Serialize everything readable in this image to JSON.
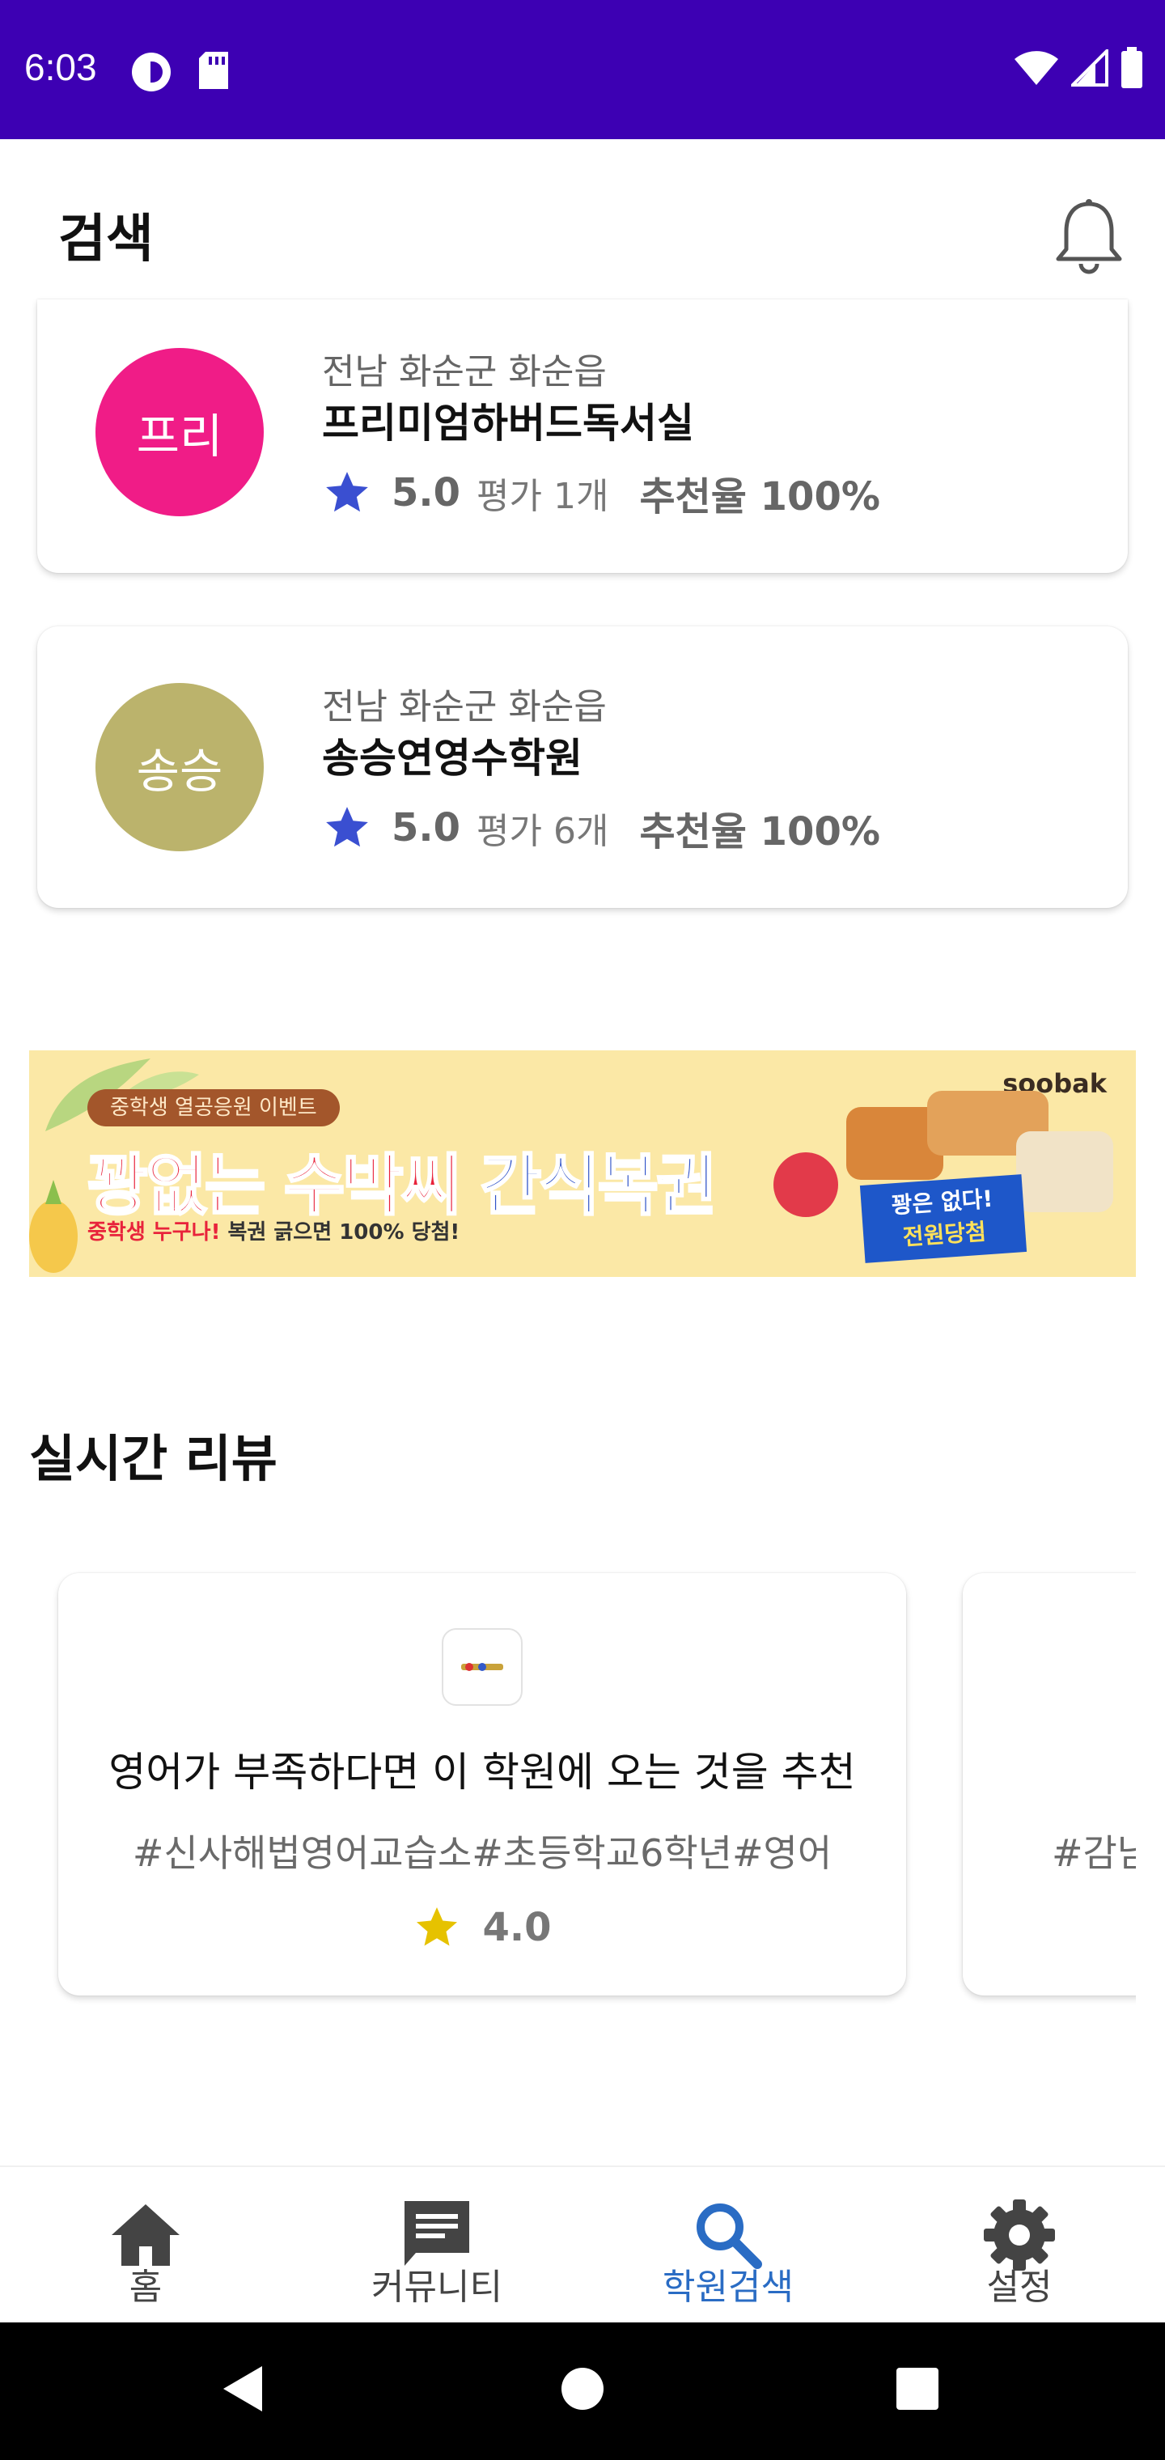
{
  "status_bar": {
    "time": "6:03",
    "bg": "#3d00b3"
  },
  "header": {
    "title": "검색",
    "notification_icon": "bell-icon"
  },
  "academies": [
    {
      "avatar_text": "프리",
      "avatar_color": "#f01c87",
      "region": "전남 화순군 화순읍",
      "name": "프리미엄하버드독서실",
      "rating": "5.0",
      "review_count": "평가 1개",
      "recommend": "추천율 100%"
    },
    {
      "avatar_text": "송승",
      "avatar_color": "#bbb36c",
      "region": "전남 화순군 화순읍",
      "name": "송승연영수학원",
      "rating": "5.0",
      "review_count": "평가 6개",
      "recommend": "추천율 100%"
    }
  ],
  "banner": {
    "badge": "중학생 열공응원 이벤트",
    "headline_red": "꽝없는 수박씨",
    "headline_blue": "간식복권",
    "sub_red": "중학생 누구나!",
    "sub_rest": " 복권 긁으면 100% 당첨!",
    "brand": "soobak",
    "stamp_line1": "꽝은 없다!",
    "stamp_line2": "전원당첨"
  },
  "reviews": {
    "section_title": "실시간 리뷰",
    "items": [
      {
        "text": "영어가 부족하다면 이 학원에 오는 것을 추천",
        "tags": "#신사해법영어교습소#초등학교6학년#영어",
        "rating": "4.0"
      },
      {
        "text": "",
        "tags": "#감남",
        "rating": ""
      }
    ]
  },
  "bottom_nav": {
    "items": [
      {
        "label": "홈",
        "icon": "home-icon"
      },
      {
        "label": "커뮤니티",
        "icon": "chat-icon"
      },
      {
        "label": "학원검색",
        "icon": "search-icon",
        "active": true
      },
      {
        "label": "설정",
        "icon": "gear-icon"
      }
    ],
    "active_color": "#2a6cc4"
  },
  "colors": {
    "star_blue": "#3a4fd1",
    "star_yellow": "#e6c200"
  }
}
